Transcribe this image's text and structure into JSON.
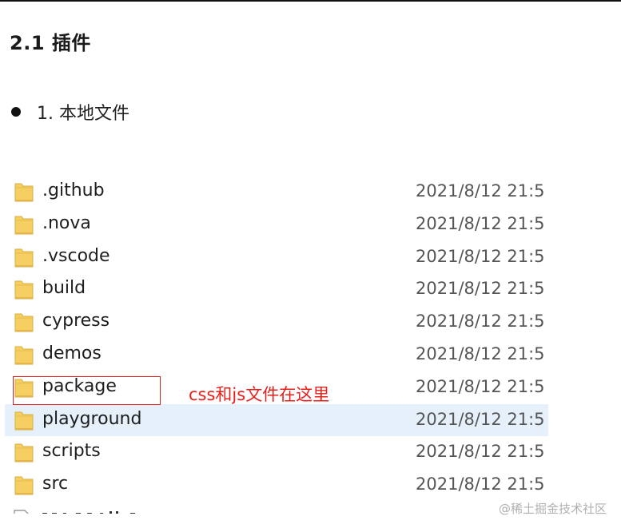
{
  "doc": {
    "heading": "2.1 插件",
    "bullet": "1. 本地文件"
  },
  "explorer": {
    "icon": "folder-icon",
    "folder_color": "#f5cf61",
    "selected_row": "playground",
    "rows": [
      {
        "name": ".github",
        "date": "2021/8/12 21:5"
      },
      {
        "name": ".nova",
        "date": "2021/8/12 21:5"
      },
      {
        "name": ".vscode",
        "date": "2021/8/12 21:5"
      },
      {
        "name": "build",
        "date": "2021/8/12 21:5"
      },
      {
        "name": "cypress",
        "date": "2021/8/12 21:5"
      },
      {
        "name": "demos",
        "date": "2021/8/12 21:5"
      },
      {
        "name": "package",
        "date": "2021/8/12 21:5"
      },
      {
        "name": "playground",
        "date": "2021/8/12 21:5"
      },
      {
        "name": "scripts",
        "date": "2021/8/12 21:5"
      },
      {
        "name": "src",
        "date": "2021/8/12 21:5"
      }
    ]
  },
  "annotation": {
    "text": "css和js文件在这里",
    "color": "#e8201b"
  },
  "watermark": "@稀土掘金技术社区"
}
